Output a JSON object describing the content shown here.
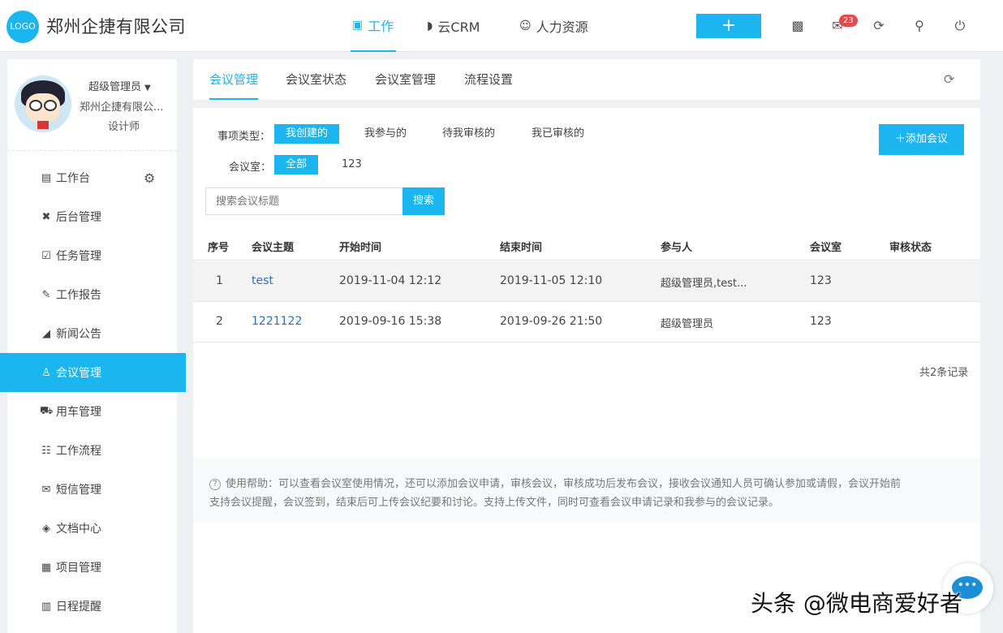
{
  "header": {
    "logo_text": "LOGO",
    "company": "郑州企捷有限公司",
    "nav": [
      {
        "icon": "briefcase-icon",
        "label": "工作"
      },
      {
        "icon": "pie-chart-icon",
        "label": "云CRM"
      },
      {
        "icon": "people-icon",
        "label": "人力资源"
      }
    ],
    "add_label": "+",
    "mail_badge": "23",
    "accent": "#1bb5f0"
  },
  "profile": {
    "name": "超级管理员",
    "company": "郑州企捷有限公...",
    "role": "设计师"
  },
  "sidebar": {
    "items": [
      {
        "label": "工作台",
        "icon": "desk-icon"
      },
      {
        "label": "后台管理",
        "icon": "tools-icon"
      },
      {
        "label": "任务管理",
        "icon": "checkbox-icon"
      },
      {
        "label": "工作报告",
        "icon": "report-icon"
      },
      {
        "label": "新闻公告",
        "icon": "megaphone-icon"
      },
      {
        "label": "会议管理",
        "icon": "meeting-icon"
      },
      {
        "label": "用车管理",
        "icon": "car-icon"
      },
      {
        "label": "工作流程",
        "icon": "flow-icon"
      },
      {
        "label": "短信管理",
        "icon": "envelope-icon"
      },
      {
        "label": "文档中心",
        "icon": "layers-icon"
      },
      {
        "label": "项目管理",
        "icon": "project-icon"
      },
      {
        "label": "日程提醒",
        "icon": "calendar-icon"
      }
    ],
    "active_index": 5
  },
  "tabs": [
    "会议管理",
    "会议室状态",
    "会议室管理",
    "流程设置"
  ],
  "filters": {
    "type_label": "事项类型：",
    "types": [
      "我创建的",
      "我参与的",
      "待我审核的",
      "我已审核的"
    ],
    "room_label": "会议室：",
    "rooms": [
      "全部",
      "123"
    ],
    "add_button": "添加会议",
    "search_placeholder": "搜索会议标题",
    "search_button": "搜索"
  },
  "table": {
    "columns": [
      "序号",
      "会议主题",
      "开始时间",
      "结束时间",
      "参与人",
      "会议室",
      "审核状态"
    ],
    "rows": [
      {
        "no": "1",
        "topic": "test",
        "start": "2019-11-04 12:12",
        "end": "2019-11-05 12:10",
        "people": "超级管理员,test...",
        "room": "123",
        "status": ""
      },
      {
        "no": "2",
        "topic": "1221122",
        "start": "2019-09-16 15:38",
        "end": "2019-09-26 21:50",
        "people": "超级管理员",
        "room": "123",
        "status": ""
      }
    ],
    "total": "共2条记录"
  },
  "help": {
    "line1": "使用帮助：可以查看会议室使用情况，还可以添加会议申请，审核会议，审核成功后发布会议，接收会议通知人员可确认参加或请假，会议开始前",
    "line2": "支持会议提醒，会议签到，结束后可上传会议纪要和讨论。支持上传文件，同时可查看会议申请记录和我参与的会议记录。"
  },
  "watermark": "头条 @微电商爱好者"
}
